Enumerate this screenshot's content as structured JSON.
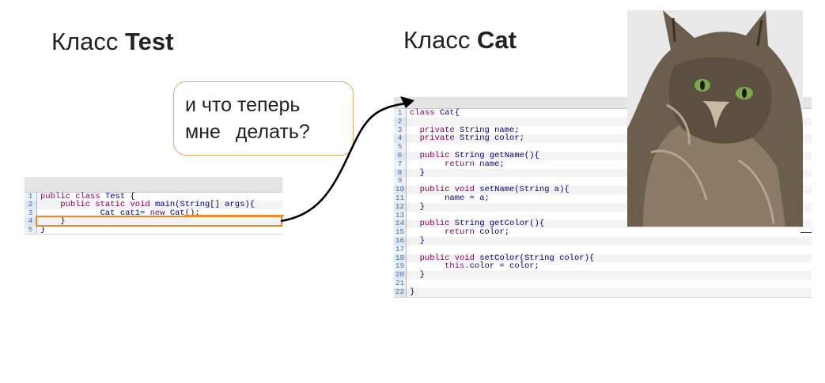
{
  "slide": {
    "title_test_prefix": "Класс ",
    "title_test_name": "Test",
    "title_cat_prefix": "Класс ",
    "title_cat_name": "Cat",
    "bubble_line1": "и что теперь",
    "bubble_line2": "мне делать?"
  },
  "code_test": {
    "lines": [
      {
        "n": "1",
        "text": "public class Test {"
      },
      {
        "n": "2",
        "text": "    public static void main(String[] args){"
      },
      {
        "n": "3",
        "text": "            Cat cat1= new Cat();"
      },
      {
        "n": "4",
        "text": "    }"
      },
      {
        "n": "5",
        "text": "}"
      }
    ]
  },
  "code_cat": {
    "lines": [
      {
        "n": "1",
        "text": "class Cat{"
      },
      {
        "n": "2",
        "text": ""
      },
      {
        "n": "3",
        "text": "  private String name;"
      },
      {
        "n": "4",
        "text": "  private String color;"
      },
      {
        "n": "5",
        "text": ""
      },
      {
        "n": "6",
        "text": "  public String getName(){"
      },
      {
        "n": "7",
        "text": "       return name;"
      },
      {
        "n": "8",
        "text": "  }"
      },
      {
        "n": "9",
        "text": ""
      },
      {
        "n": "10",
        "text": "  public void setName(String a){"
      },
      {
        "n": "11",
        "text": "       name = a;"
      },
      {
        "n": "12",
        "text": "  }"
      },
      {
        "n": "13",
        "text": ""
      },
      {
        "n": "14",
        "text": "  public String getColor(){"
      },
      {
        "n": "15",
        "text": "       return color;"
      },
      {
        "n": "16",
        "text": "  }"
      },
      {
        "n": "17",
        "text": ""
      },
      {
        "n": "18",
        "text": "  public void setColor(String color){"
      },
      {
        "n": "19",
        "text": "       this.color = color;"
      },
      {
        "n": "20",
        "text": "  }"
      },
      {
        "n": "21",
        "text": ""
      },
      {
        "n": "22",
        "text": "}"
      }
    ]
  },
  "colors": {
    "highlight": "#ef8a2e",
    "bubble_border": "#e3a868",
    "keyword": "#7f0055",
    "line_number": "#3a6fb0"
  },
  "image": {
    "subject": "cat-photo"
  }
}
